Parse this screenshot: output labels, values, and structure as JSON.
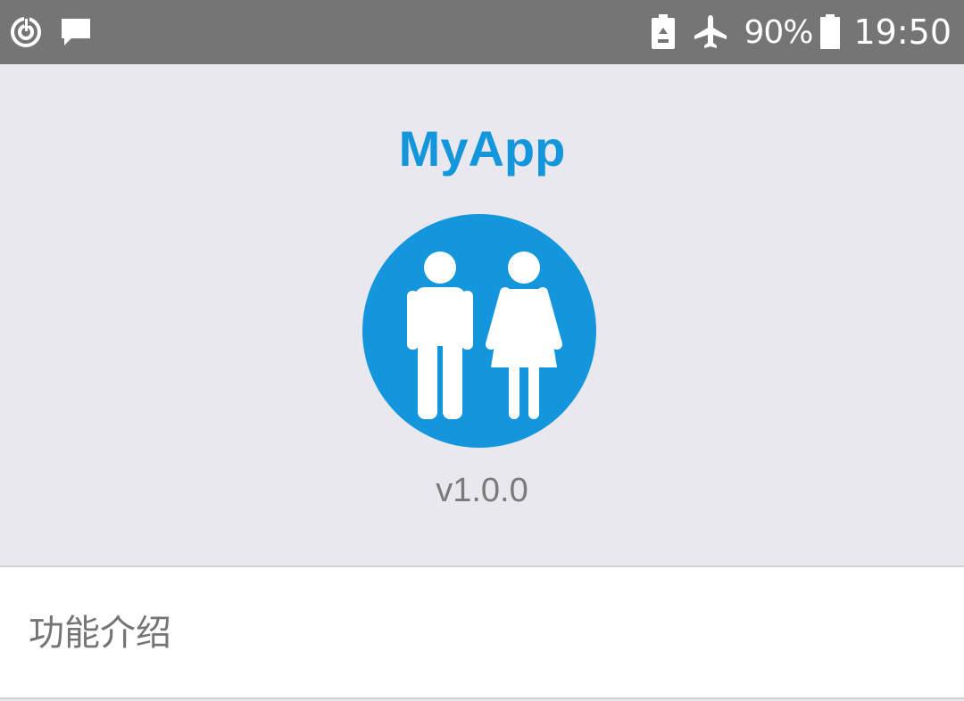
{
  "status_bar": {
    "left_icons": [
      "sync-icon",
      "message-icon"
    ],
    "right_icons": [
      "battery-saver-icon",
      "airplane-mode-icon",
      "battery-icon"
    ],
    "battery_percent": "90%",
    "time": "19:50"
  },
  "about": {
    "app_name": "MyApp",
    "logo_icon": "people-icon",
    "version": "v1.0.0"
  },
  "menu": {
    "items": [
      {
        "label": "功能介绍"
      }
    ]
  },
  "colors": {
    "accent": "#1496dc",
    "status_bar": "#757575",
    "background": "#e9e8ef",
    "muted_text": "#757575"
  }
}
